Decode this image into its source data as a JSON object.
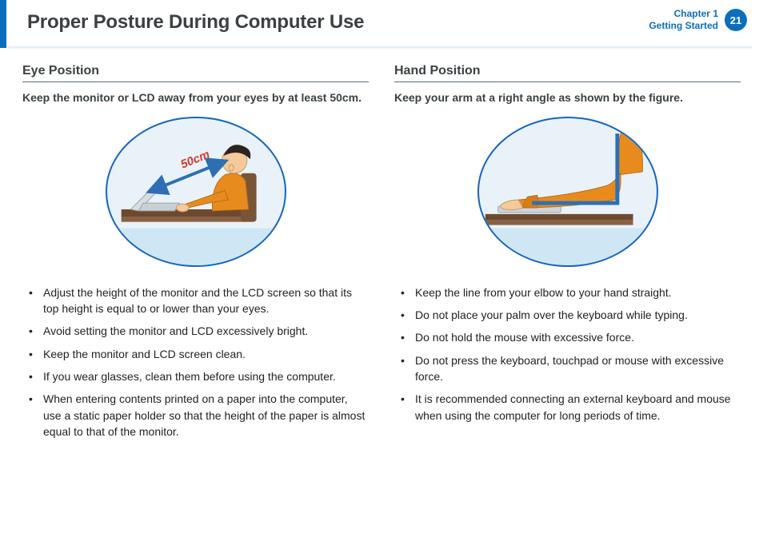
{
  "header": {
    "title": "Proper Posture During Computer Use",
    "chapter_line1": "Chapter 1",
    "chapter_line2": "Getting Started",
    "page_number": "21"
  },
  "left": {
    "section_title": "Eye Position",
    "lead": "Keep the monitor or LCD away from your eyes by at least 50cm.",
    "distance_label": "50cm",
    "bullets": [
      "Adjust the height of the monitor and the LCD screen so that its top height is equal to or lower than your eyes.",
      "Avoid setting the monitor and LCD excessively bright.",
      "Keep the monitor and LCD screen clean.",
      "If you wear glasses, clean them before using the computer.",
      "When entering contents printed on a paper into the computer, use a static paper holder so that the height of the paper is almost equal to that of the monitor."
    ]
  },
  "right": {
    "section_title": "Hand Position",
    "lead": "Keep your arm at a right angle as shown by the figure.",
    "bullets": [
      "Keep the line from your elbow to your hand straight.",
      "Do not place your palm over the keyboard while typing.",
      "Do not hold the mouse with excessive force.",
      "Do not press the keyboard, touchpad or mouse with excessive force.",
      "It is recommended connecting an external keyboard and mouse when using the computer for long periods of time."
    ]
  }
}
